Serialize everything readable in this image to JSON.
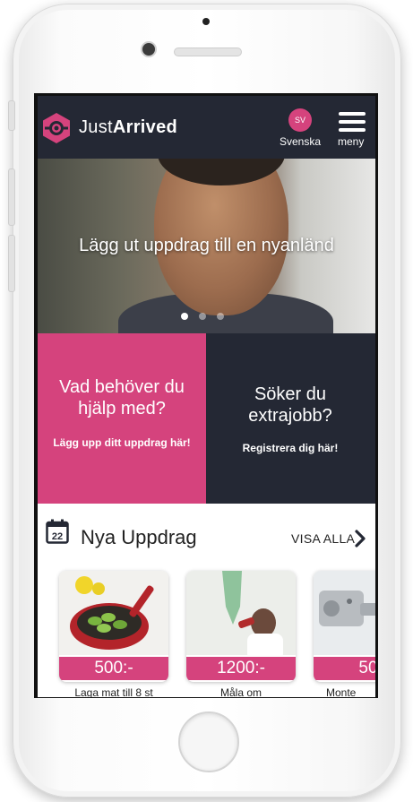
{
  "device": {
    "frame_color": "#ffffff"
  },
  "header": {
    "brand_light": "Just",
    "brand_bold": "Arrived",
    "lang_code": "SV",
    "lang_label": "Svenska",
    "menu_label": "meny",
    "logo_icon": "justarrived-hexagon-icon",
    "menu_icon": "hamburger-icon"
  },
  "hero": {
    "text": "Lägg ut uppdrag till en nyanländ",
    "slide_count": 3,
    "active_slide": 1
  },
  "cta": {
    "left_title": "Vad behöver du hjälp med?",
    "left_sub": "Lägg upp ditt uppdrag här!",
    "right_title": "Söker du extrajobb?",
    "right_sub": "Registrera dig här!"
  },
  "jobs": {
    "calendar_day": "22",
    "title": "Nya Uppdrag",
    "visa_alla": "VISA ALLA",
    "cards": [
      {
        "price": "500:-",
        "title": "Laga mat till 8 st",
        "image": "pan-with-limes"
      },
      {
        "price": "1200:-",
        "title": "Måla om",
        "image": "painting-wall"
      },
      {
        "price": "50",
        "title": "Monte",
        "image": "hinges"
      }
    ]
  },
  "colors": {
    "brand_pink": "#d5437d",
    "brand_dark": "#242834"
  }
}
